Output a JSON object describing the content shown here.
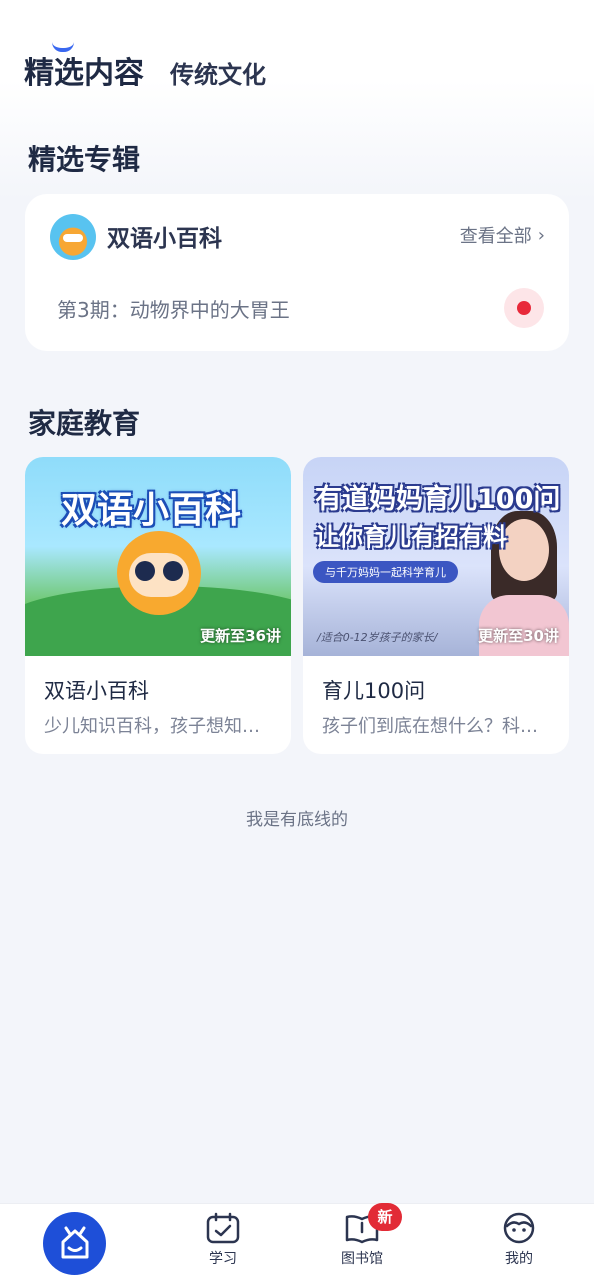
{
  "tabs": {
    "active": "精选内容",
    "inactive": "传统文化"
  },
  "featured": {
    "section_title": "精选专辑",
    "album_name": "双语小百科",
    "view_all": "查看全部",
    "episode": "第3期：动物界中的大胃王"
  },
  "family": {
    "section_title": "家庭教育",
    "cards": [
      {
        "cover_title": "双语小百科",
        "badge": "更新至36讲",
        "title": "双语小百科",
        "subtitle": "少儿知识百科，孩子想知…"
      },
      {
        "cover_line1": "有道妈妈育儿100问",
        "cover_line2": "让你育儿有招有料",
        "cover_pill": "与千万妈妈一起科学育儿",
        "cover_note": "/适合0-12岁孩子的家长/",
        "badge": "更新至30讲",
        "title": "育儿100问",
        "subtitle": "孩子们到底在想什么？科…"
      }
    ]
  },
  "footer_note": "我是有底线的",
  "nav": {
    "study": "学习",
    "library": "图书馆",
    "library_badge": "新",
    "mine": "我的"
  },
  "colors": {
    "accent": "#1e4fd8",
    "badge": "#e22b36",
    "play": "#e8293a"
  }
}
